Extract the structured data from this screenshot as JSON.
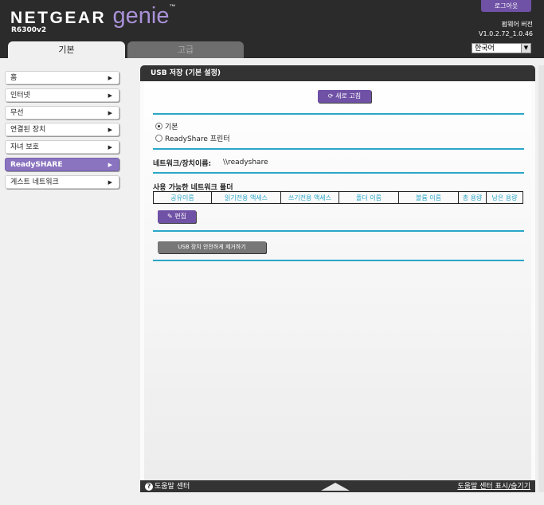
{
  "header": {
    "brand": "NETGEAR",
    "product": "genie",
    "trademark": "™",
    "model": "R6300v2",
    "logout_label": "로그아웃",
    "firmware_label": "펌웨어 버전",
    "firmware_version": "V1.0.2.72_1.0.46",
    "language": "한국어"
  },
  "tabs": {
    "basic": "기본",
    "advanced": "고급"
  },
  "sidebar": {
    "items": [
      {
        "label": "홈"
      },
      {
        "label": "인터넷"
      },
      {
        "label": "무선"
      },
      {
        "label": "연결된 장치"
      },
      {
        "label": "자녀 보호"
      },
      {
        "label": "ReadySHARE"
      },
      {
        "label": "게스트 네트워크"
      }
    ]
  },
  "panel": {
    "title": "USB 저장 (기본 설정)",
    "refresh_label": "새로 고침",
    "radio_basic": "기본",
    "radio_printer": "ReadyShare 프린터",
    "network_device_label": "네트워크/장치이름:",
    "network_device_value": "\\\\readyshare",
    "folders_heading": "사용 가능한 네트워크 폴더",
    "table_headers": [
      "공유이름",
      "읽기전용 액세스",
      "쓰기전용 액세스",
      "폴더 이름",
      "볼륨 이름",
      "총 용량",
      "남은 용량"
    ],
    "edit_label": "편집",
    "remove_label": "USB 장치 안전하게 제거하기"
  },
  "footer": {
    "help_center": "도움말 센터",
    "toggle_help": "도움말 센터 표시/숨기기"
  }
}
